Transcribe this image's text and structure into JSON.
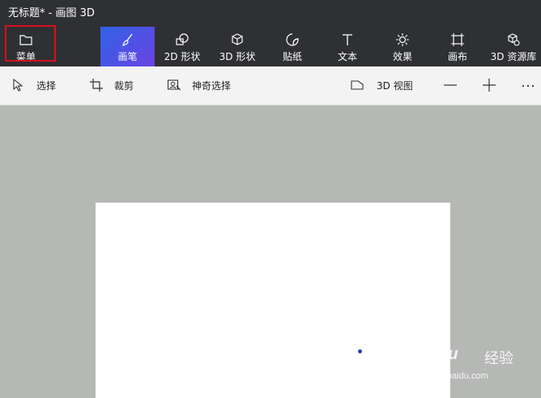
{
  "window": {
    "title": "无标题* - 画图 3D"
  },
  "toolbar": {
    "items": [
      {
        "label": "菜单",
        "icon": "folder-icon"
      },
      {
        "label": "画笔",
        "icon": "brush-icon",
        "active": true
      },
      {
        "label": "2D 形状",
        "icon": "2d-shapes-icon"
      },
      {
        "label": "3D 形状",
        "icon": "3d-cube-icon"
      },
      {
        "label": "贴纸",
        "icon": "sticker-icon"
      },
      {
        "label": "文本",
        "icon": "text-icon"
      },
      {
        "label": "效果",
        "icon": "sun-icon"
      },
      {
        "label": "画布",
        "icon": "canvas-icon"
      },
      {
        "label": "3D 资源库",
        "icon": "3d-library-icon"
      }
    ],
    "accent": "#4a5ae6",
    "highlight_color": "#d8101d"
  },
  "subbar": {
    "select": "选择",
    "crop": "裁剪",
    "magic_select": "神奇选择",
    "view3d": "3D 视图",
    "zoom_out": "—",
    "zoom_in": "+",
    "more": "···"
  },
  "watermark": {
    "brand": "Baidu",
    "brand2": "经验",
    "url": "jingyan.baidu.com"
  }
}
